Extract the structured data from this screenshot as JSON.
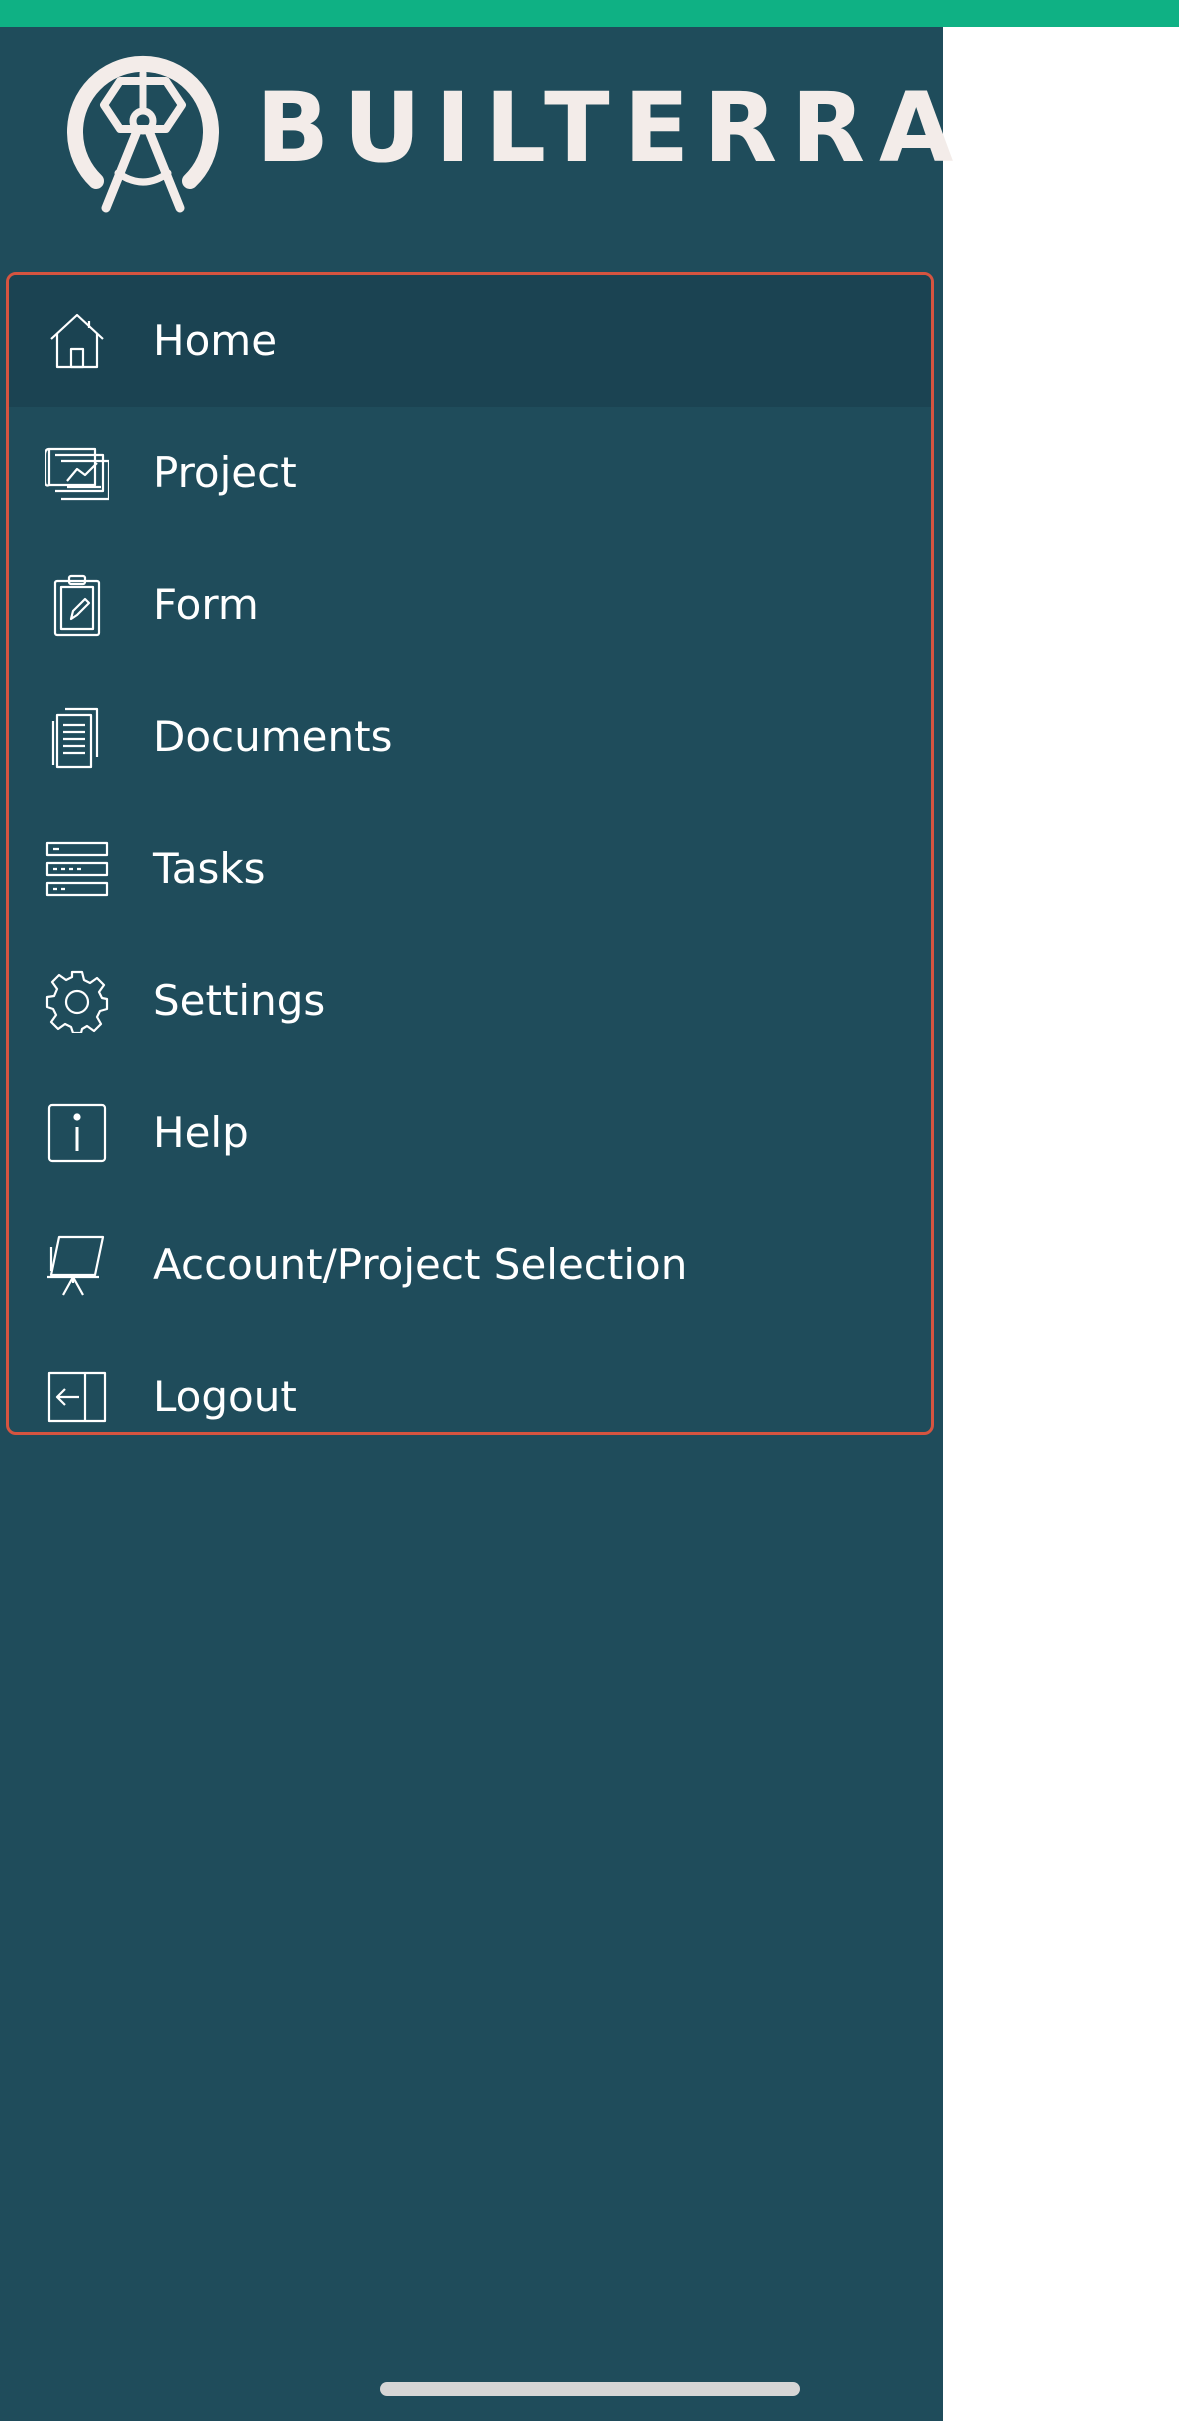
{
  "brand": {
    "name": "BUILTERRA",
    "status_bar_color": "#0fb184",
    "drawer_color": "#1f4c5b",
    "highlight_color": "#d55440"
  },
  "menu": {
    "items": [
      {
        "label": "Home",
        "icon": "home-icon",
        "active": true
      },
      {
        "label": "Project",
        "icon": "blueprint-icon",
        "active": false
      },
      {
        "label": "Form",
        "icon": "clipboard-icon",
        "active": false
      },
      {
        "label": "Documents",
        "icon": "documents-icon",
        "active": false
      },
      {
        "label": "Tasks",
        "icon": "tasks-icon",
        "active": false
      },
      {
        "label": "Settings",
        "icon": "gear-icon",
        "active": false
      },
      {
        "label": "Help",
        "icon": "info-icon",
        "active": false
      },
      {
        "label": "Account/Project Selection",
        "icon": "easel-icon",
        "active": false
      },
      {
        "label": "Logout",
        "icon": "logout-icon",
        "active": false
      }
    ]
  }
}
